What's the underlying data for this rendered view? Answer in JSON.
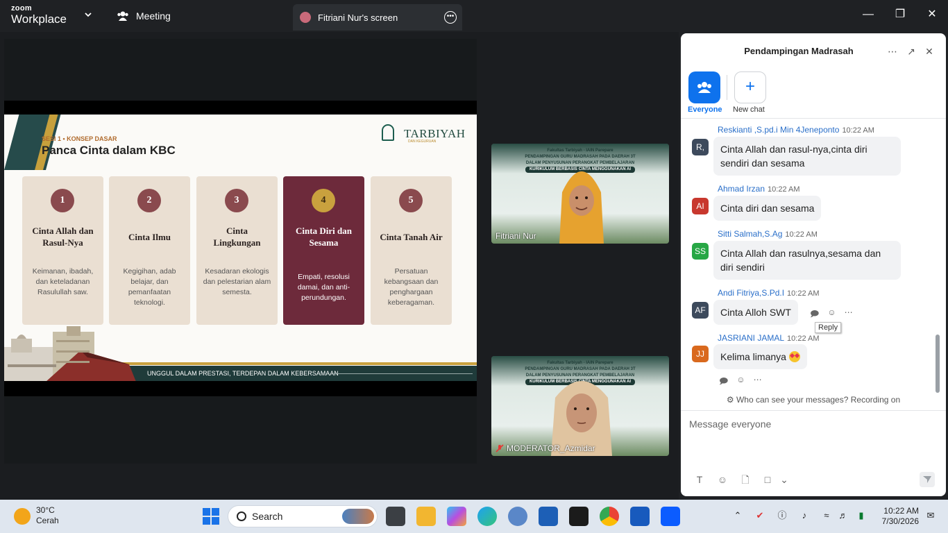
{
  "app": {
    "logo_top": "zoom",
    "logo_bottom": "Workplace",
    "meeting_tab": "Meeting",
    "screen_tab": "Fitriani Nur's screen"
  },
  "slide": {
    "session": "SESI 1 • KONSEP DASAR",
    "title": "Panca Cinta dalam KBC",
    "brand": "TARBIYAH",
    "brand_sub": "DAN KEGURUAN",
    "cards": [
      {
        "num": "1",
        "title": "Cinta Allah dan Rasul-Nya",
        "desc": "Keimanan, ibadah, dan keteladanan Rasulullah saw."
      },
      {
        "num": "2",
        "title": "Cinta Ilmu",
        "desc": "Kegigihan, adab belajar, dan pemanfaatan teknologi."
      },
      {
        "num": "3",
        "title": "Cinta Lingkungan",
        "desc": "Kesadaran ekologis dan pelestarian alam semesta."
      },
      {
        "num": "4",
        "title": "Cinta Diri dan Sesama",
        "desc": "Empati, resolusi damai, dan anti-perundungan."
      },
      {
        "num": "5",
        "title": "Cinta Tanah Air",
        "desc": "Persatuan kebangsaan dan penghargaan keberagaman."
      }
    ],
    "footer": "UNGGUL DALAM PRESTASI, TERDEPAN DALAM KEBERSAMAAN",
    "active_card": 4
  },
  "videos": [
    {
      "name": "Fitriani Nur",
      "banner1": "Fakultas Tarbiyah - IAIN Parepare",
      "banner2": "PENDAMPINGAN GURU MADRASAH PADA DAERAH 3T",
      "banner3": "DALAM PENYUSUNAN PERANGKAT PEMBELAJARAN",
      "banner4": "KURIKULUM BERBASIS CINTA MENGGUNAKAN AI"
    },
    {
      "name": "MODERATOR_Azmidar",
      "banner1": "Fakultas Tarbiyah - IAIN Parepare",
      "banner2": "PENDAMPINGAN GURU MADRASAH PADA DAERAH 3T",
      "banner3": "DALAM PENYUSUNAN PERANGKAT PEMBELAJARAN",
      "banner4": "KURIKULUM BERBASIS CINTA MENGGUNAKAN AI"
    }
  ],
  "chat": {
    "title": "Pendampingan Madrasah",
    "tab_everyone": "Everyone",
    "tab_new": "New chat",
    "messages": [
      {
        "initials": "R,",
        "color": "#3d4a5c",
        "sender": "Reskianti ,S.pd.i Min 4Jeneponto",
        "time": "10:22 AM",
        "text": "Cinta Allah dan rasul-nya,cinta diri sendiri dan sesama"
      },
      {
        "initials": "AI",
        "color": "#c8382e",
        "sender": "Ahmad Irzan",
        "time": "10:22 AM",
        "text": "Cinta diri dan sesama"
      },
      {
        "initials": "SS",
        "color": "#27a745",
        "sender": "Sitti Salmah,S.Ag",
        "time": "10:22 AM",
        "text": "Cinta Allah dan rasulnya,sesama dan diri sendiri"
      },
      {
        "initials": "AF",
        "color": "#3d4a5c",
        "sender": "Andi Fitriya,S.Pd.I",
        "time": "10:22 AM",
        "text": "Cinta Alloh SWT"
      },
      {
        "initials": "JJ",
        "color": "#d9691e",
        "sender": "JASRIANI JAMAL",
        "time": "10:22 AM",
        "text": "Kelima limanya"
      }
    ],
    "tooltip": "Reply",
    "visibility": "Who can see your messages? Recording on",
    "composer_placeholder": "Message everyone"
  },
  "taskbar": {
    "temp": "30°C",
    "weather": "Cerah",
    "search": "Search",
    "time": "10:22 AM",
    "date": "7/30/2026"
  }
}
